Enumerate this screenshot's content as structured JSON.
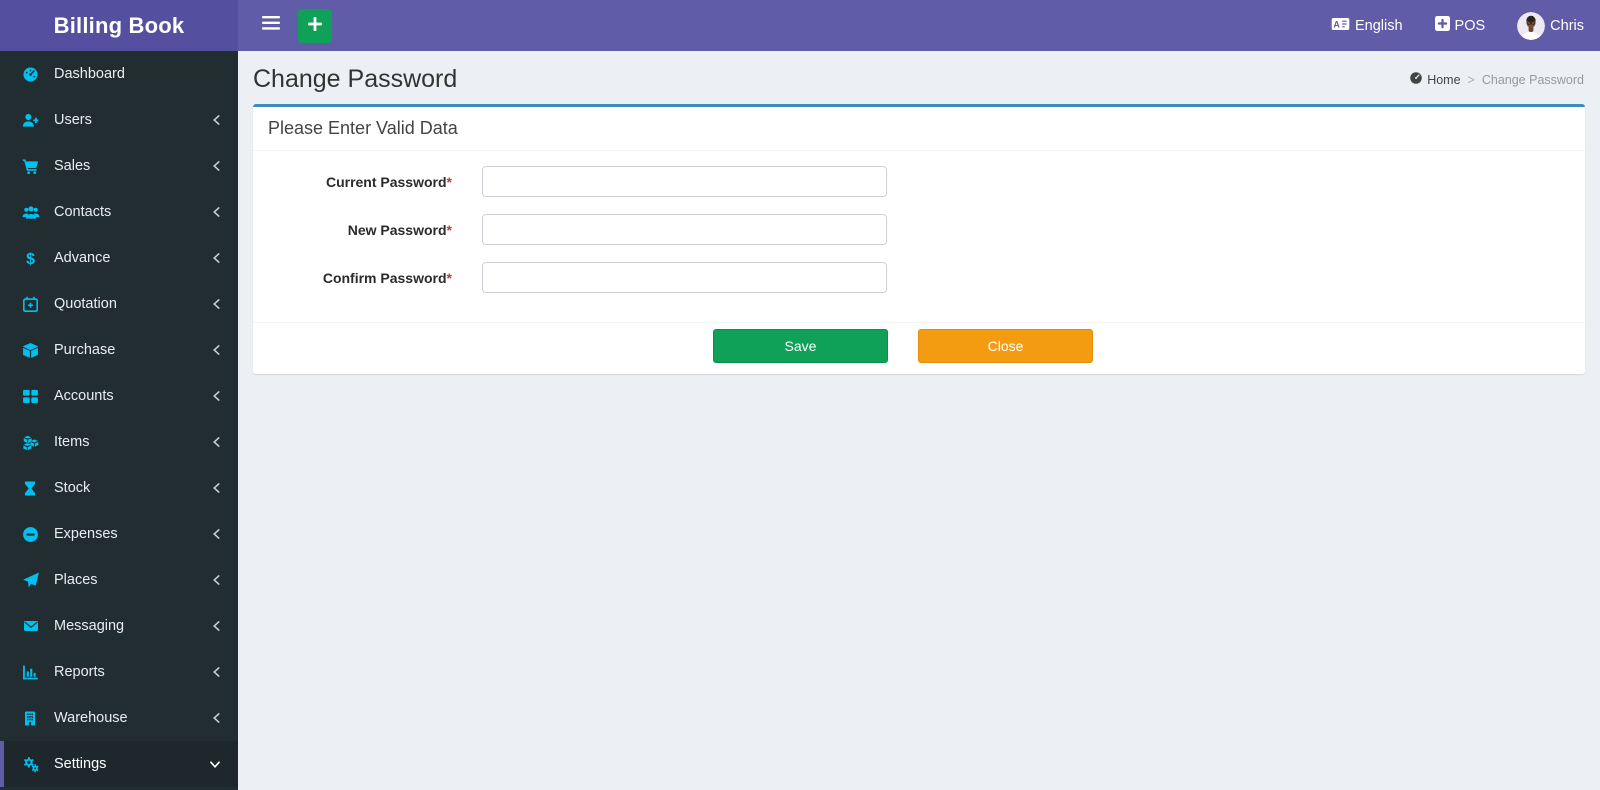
{
  "header": {
    "brand": "Billing Book",
    "language_label": "English",
    "pos_label": "POS",
    "user_name": "Chris"
  },
  "sidebar": {
    "items": [
      {
        "label": "Dashboard",
        "icon": "dashboard-icon",
        "chevron": "none",
        "active": false
      },
      {
        "label": "Users",
        "icon": "user-plus-icon",
        "chevron": "left",
        "active": false
      },
      {
        "label": "Sales",
        "icon": "cart-icon",
        "chevron": "left",
        "active": false
      },
      {
        "label": "Contacts",
        "icon": "users-icon",
        "chevron": "left",
        "active": false
      },
      {
        "label": "Advance",
        "icon": "dollar-icon",
        "chevron": "left",
        "active": false
      },
      {
        "label": "Quotation",
        "icon": "calendar-plus-icon",
        "chevron": "left",
        "active": false
      },
      {
        "label": "Purchase",
        "icon": "cube-icon",
        "chevron": "left",
        "active": false
      },
      {
        "label": "Accounts",
        "icon": "grid-icon",
        "chevron": "left",
        "active": false
      },
      {
        "label": "Items",
        "icon": "cubes-icon",
        "chevron": "left",
        "active": false
      },
      {
        "label": "Stock",
        "icon": "hourglass-icon",
        "chevron": "left",
        "active": false
      },
      {
        "label": "Expenses",
        "icon": "minus-circle-icon",
        "chevron": "left",
        "active": false
      },
      {
        "label": "Places",
        "icon": "paper-plane-icon",
        "chevron": "left",
        "active": false
      },
      {
        "label": "Messaging",
        "icon": "envelope-icon",
        "chevron": "left",
        "active": false
      },
      {
        "label": "Reports",
        "icon": "bar-chart-icon",
        "chevron": "left",
        "active": false
      },
      {
        "label": "Warehouse",
        "icon": "building-icon",
        "chevron": "left",
        "active": false
      },
      {
        "label": "Settings",
        "icon": "gears-icon",
        "chevron": "down",
        "active": true
      }
    ]
  },
  "page": {
    "title": "Change Password",
    "breadcrumb": {
      "home_label": "Home",
      "separator": ">",
      "current": "Change Password"
    }
  },
  "form": {
    "card_title": "Please Enter Valid Data",
    "required_marker": "*",
    "fields": [
      {
        "label": "Current Password",
        "required": true,
        "value": "",
        "placeholder": ""
      },
      {
        "label": "New Password",
        "required": true,
        "value": "",
        "placeholder": ""
      },
      {
        "label": "Confirm Password",
        "required": true,
        "value": "",
        "placeholder": ""
      }
    ],
    "save_label": "Save",
    "close_label": "Close"
  },
  "colors": {
    "header_purple": "#605ca8",
    "brand_purple": "#544f9e",
    "sidebar_dark": "#222d32",
    "sidebar_active_bg": "#1e282c",
    "sidebar_icon_cyan": "#00c0ef",
    "card_top_border_blue": "#3c8dbc",
    "save_green": "#0fa157",
    "close_orange": "#f39c12",
    "content_bg": "#ecf0f5"
  }
}
